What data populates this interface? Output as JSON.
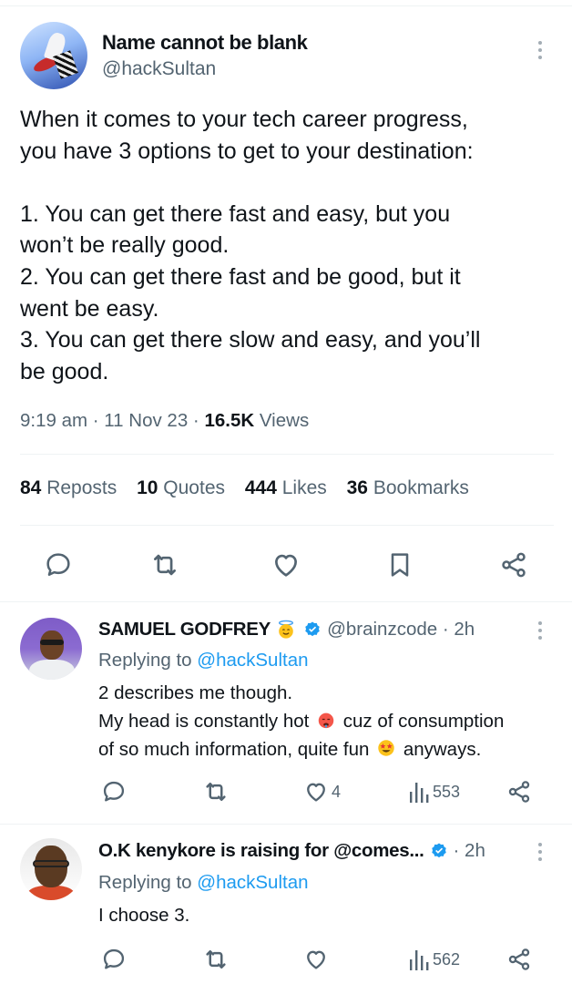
{
  "tweet": {
    "display_name": "Name cannot be blank",
    "handle": "@hackSultan",
    "lines": [
      "When it comes to your tech career progress,",
      "you have 3 options to get to your destination:",
      "",
      "1. You can get there fast and easy, but you",
      "won’t be really good.",
      "2. You can get there fast and be good, but it",
      "went be easy.",
      "3. You can get there slow and easy, and you’ll",
      "be good."
    ],
    "time": "9:19 am",
    "date": "11 Nov 23",
    "views_count": "16.5K",
    "views_label": "Views",
    "stats": {
      "reposts_count": "84",
      "reposts_label": "Reposts",
      "quotes_count": "10",
      "quotes_label": "Quotes",
      "likes_count": "444",
      "likes_label": "Likes",
      "bookmarks_count": "36",
      "bookmarks_label": "Bookmarks"
    },
    "actions": [
      "reply-icon",
      "repost-icon",
      "like-icon",
      "bookmark-icon",
      "share-icon"
    ]
  },
  "replies": [
    {
      "display_name": "SAMUEL GODFREY",
      "name_emoji": "smiling-face-with-halo",
      "verified": true,
      "handle_time": "@brainzcode · 2h",
      "replying_prefix": "Replying to",
      "replying_to": "@hackSultan",
      "line1": "2 describes me though.",
      "line2_a": "My head is constantly hot",
      "line2_emoji": "hot-face",
      "line2_b": "cuz of consumption",
      "line3_a": "of so much information, quite fun",
      "line3_emoji": "star-struck",
      "line3_b": "anyways.",
      "likes": "4",
      "views": "553"
    },
    {
      "display_name": "O.K kenykore is raising for @comes...",
      "verified": true,
      "handle_time": "· 2h",
      "replying_prefix": "Replying to",
      "replying_to": "@hackSultan",
      "line1": "I choose 3.",
      "likes": "",
      "views": "562"
    }
  ],
  "colors": {
    "text": "#0f1419",
    "secondary": "#536471",
    "accent": "#1d9bf0",
    "divider": "#eff3f4"
  }
}
